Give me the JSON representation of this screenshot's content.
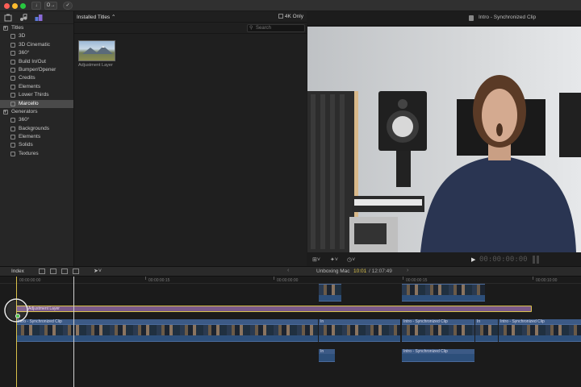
{
  "titlebar": {
    "key_label": "O→"
  },
  "library": {
    "items": [
      {
        "label": "Titles",
        "level": 0,
        "expanded": true
      },
      {
        "label": "3D",
        "level": 1
      },
      {
        "label": "3D Cinematic",
        "level": 1
      },
      {
        "label": "360°",
        "level": 1
      },
      {
        "label": "Build In/Out",
        "level": 1
      },
      {
        "label": "Bumper/Opener",
        "level": 1
      },
      {
        "label": "Credits",
        "level": 1
      },
      {
        "label": "Elements",
        "level": 1
      },
      {
        "label": "Lower Thirds",
        "level": 1
      },
      {
        "label": "Marcello",
        "level": 1,
        "selected": true
      },
      {
        "label": "Generators",
        "level": 0,
        "expanded": true
      },
      {
        "label": "360°",
        "level": 1
      },
      {
        "label": "Backgrounds",
        "level": 1
      },
      {
        "label": "Elements",
        "level": 1
      },
      {
        "label": "Solids",
        "level": 1
      },
      {
        "label": "Textures",
        "level": 1
      }
    ]
  },
  "browser": {
    "header": "Installed Titles ⌃",
    "filter_4k": "4K Only",
    "search_placeholder": "Search",
    "items": [
      {
        "label": "Adjustment Layer"
      }
    ]
  },
  "viewer": {
    "title": "Intro - Synchronized Clip",
    "timecode": "00:00:00:00"
  },
  "timeline_toolbar": {
    "index_label": "Index",
    "project_name": "Unboxing Mac",
    "position": "10:01",
    "duration": "/ 12:07:49"
  },
  "timeline": {
    "ruler": [
      "00:00:00:00",
      "00:00:00:15",
      "00:00:00:00",
      "00:00:00:15",
      "00:00:10:00"
    ],
    "adjustment_clip": "Adjustment Layer",
    "clip_label": "Intro - Synchronized Clip",
    "clip_label_short": "In"
  },
  "colors": {
    "accent": "#d9c14a",
    "selection": "#4a4a4a",
    "clip_blue": "#3c5a86",
    "adjustment_purple": "#7b5a8a"
  }
}
